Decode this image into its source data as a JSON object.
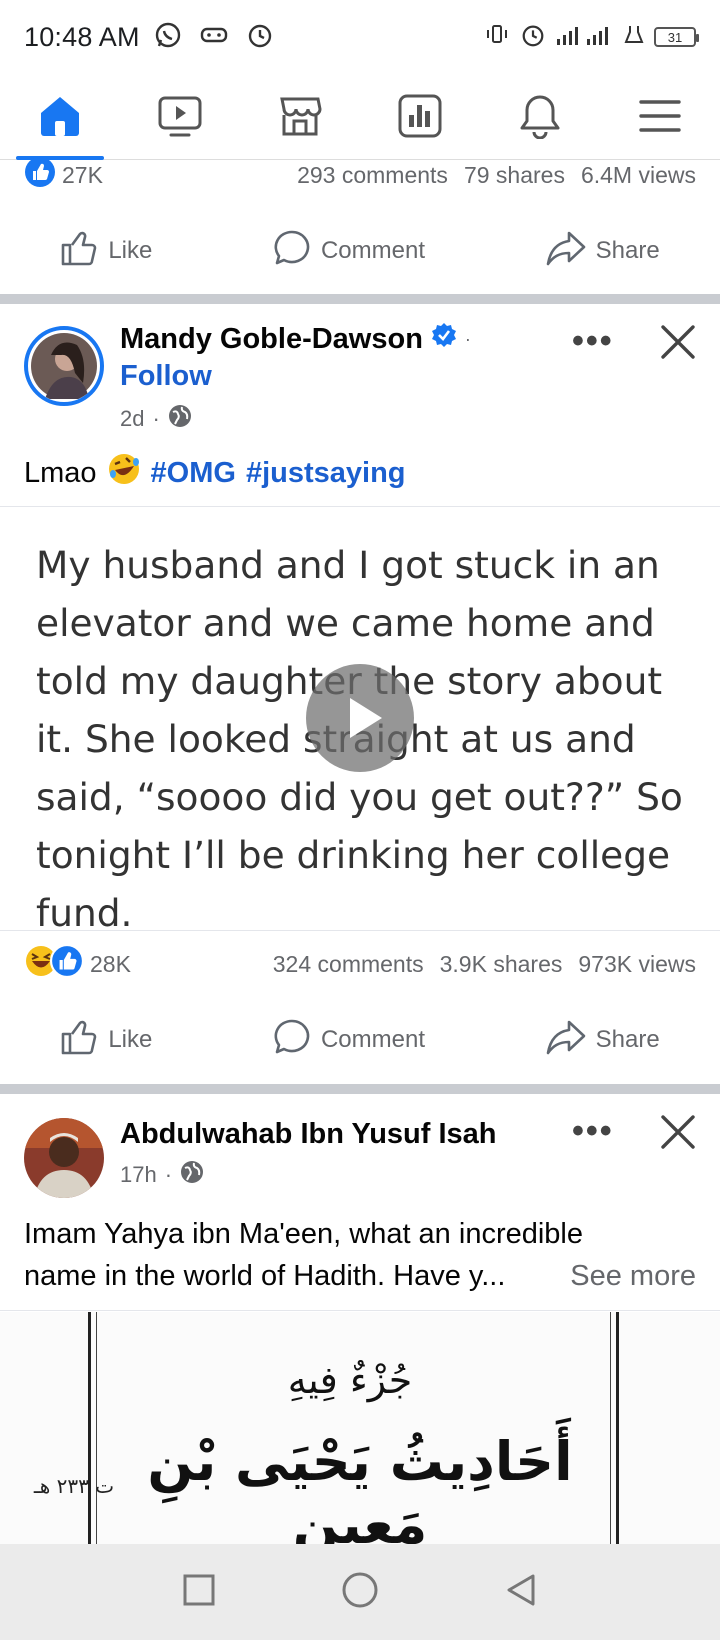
{
  "status_bar": {
    "time": "10:48 AM",
    "battery": "31"
  },
  "nav": {
    "items": [
      {
        "icon": "home-icon",
        "active": true
      },
      {
        "icon": "video-icon",
        "active": false
      },
      {
        "icon": "marketplace-icon",
        "active": false
      },
      {
        "icon": "dashboard-icon",
        "active": false
      },
      {
        "icon": "bell-icon",
        "active": false
      },
      {
        "icon": "menu-icon",
        "active": false
      }
    ]
  },
  "prev_post": {
    "reactions_count": "27K",
    "comments": "293 comments",
    "shares": "79 shares",
    "views": "6.4M views"
  },
  "actions": {
    "like": "Like",
    "comment": "Comment",
    "share": "Share"
  },
  "post1": {
    "author": "Mandy Goble-Dawson",
    "follow": "Follow",
    "time": "2d",
    "caption_text": "Lmao",
    "hashtag1": "#OMG",
    "hashtag2": "#justsaying",
    "quote": "My husband and I got stuck in an elevator and we came home and told my daughter the story about it. She looked straight at us and said, “soooo did you get out??” So tonight I’ll be drinking her college fund.",
    "reactions_count": "28K",
    "comments": "324 comments",
    "shares": "3.9K shares",
    "views": "973K views"
  },
  "post2": {
    "author": "Abdulwahab Ibn Yusuf Isah",
    "time": "17h",
    "caption_line1": "Imam Yahya ibn Ma'een, what an incredible",
    "caption_line2": "name in the world of Hadith. Have y...",
    "see_more": "See more",
    "image_title": "جُزْءٌ فِيهِ",
    "image_subtitle": "أَحَادِيثُ يَحْيَى بْنِ مَعِين",
    "image_note": "ت ٢٣٣ هـ"
  },
  "colors": {
    "brand": "#1877f2",
    "hashtag": "#1b5fcf",
    "secondary_text": "#65676b"
  }
}
